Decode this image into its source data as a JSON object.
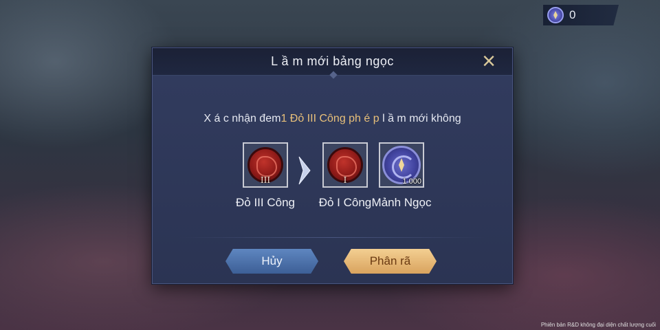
{
  "currency": {
    "icon": "gem-icon",
    "value": "0"
  },
  "dialog": {
    "title": "L ầ m mới bảng ngọc",
    "message_prefix": "X á c nhận đem",
    "message_highlight": "1 Đỏ III Công ph é p",
    "message_suffix": " l ầ m mới không",
    "items": [
      {
        "name": "Đỏ III Công",
        "tier": "III",
        "icon": "red-rune-icon"
      },
      {
        "name": "Đỏ I Công",
        "tier": "I",
        "icon": "red-rune-icon"
      },
      {
        "name": "Mảnh Ngọc",
        "count": "1 000",
        "icon": "gem-shard-icon"
      }
    ],
    "cancel_label": "Hủy",
    "confirm_label": "Phân rã"
  },
  "footer_note": "Phiên bản R&D không đại diện chất lượng cuối",
  "colors": {
    "highlight": "#e8c07a",
    "cancel": "#4f74ae",
    "confirm": "#e6b674"
  }
}
